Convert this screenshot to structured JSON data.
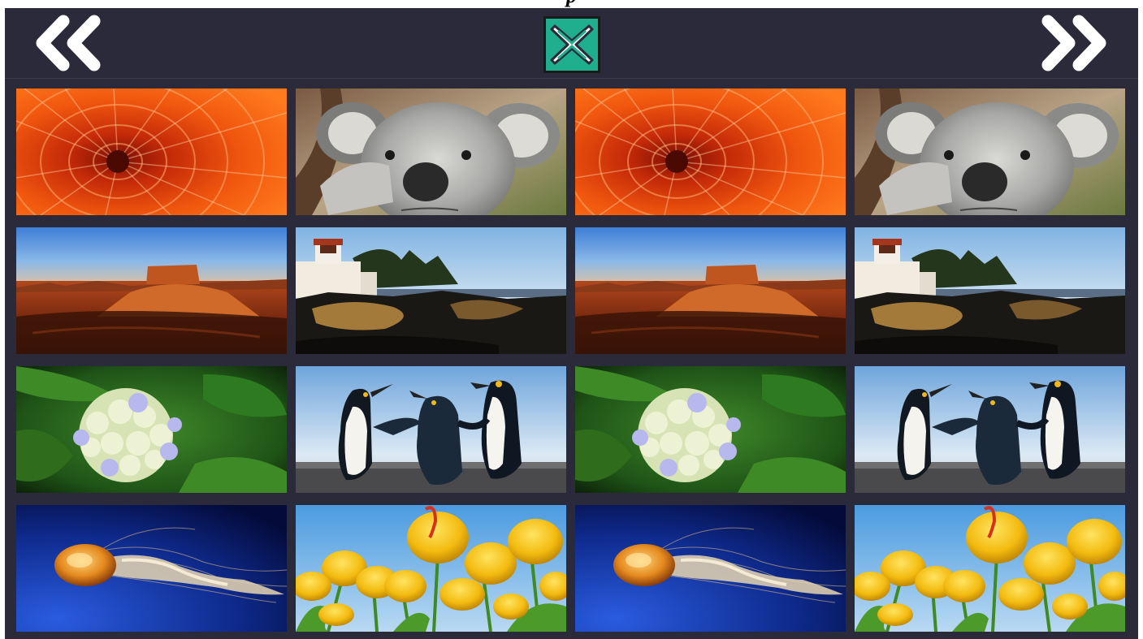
{
  "window": {
    "title_fragment": "p"
  },
  "header": {
    "prev_icon": "double-chevron-left-icon",
    "next_icon": "double-chevron-right-icon",
    "close_icon": "close-x-icon",
    "colors": {
      "background": "#2b2a3a",
      "icon": "#ffffff",
      "close_accent": "#1fae8e"
    }
  },
  "gallery": {
    "rows": [
      [
        "chrysanthemum",
        "koala",
        "chrysanthemum",
        "koala"
      ],
      [
        "desert",
        "lighthouse",
        "desert",
        "lighthouse"
      ],
      [
        "hydrangeas",
        "penguins",
        "hydrangeas",
        "penguins"
      ],
      [
        "jellyfish",
        "tulips",
        "jellyfish",
        "tulips"
      ]
    ]
  }
}
